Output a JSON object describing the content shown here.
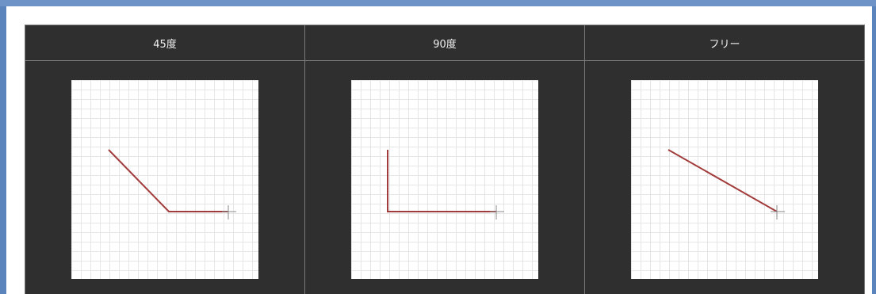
{
  "columns": [
    {
      "header": "45度",
      "mode": "45-degree"
    },
    {
      "header": "90度",
      "mode": "90-degree"
    },
    {
      "header": "フリー",
      "mode": "free"
    }
  ],
  "colors": {
    "frame": "#5b84bd",
    "panel_bg": "#2f2f2f",
    "header_text": "#f2f2f2",
    "line": "#a23c3c",
    "grid": "#e6e6e6"
  }
}
